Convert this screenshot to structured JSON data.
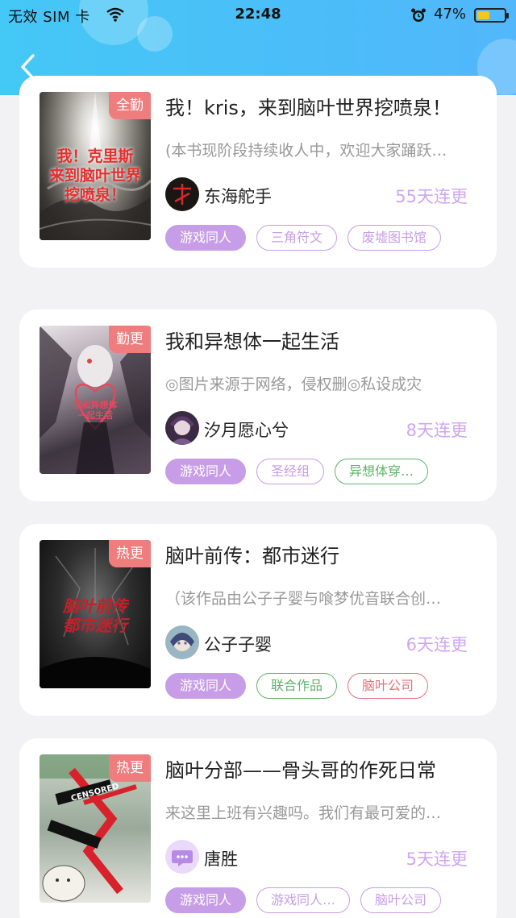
{
  "status_bar": {
    "carrier": "无效 SIM 卡",
    "time": "22:48",
    "battery": "47%",
    "battery_level": 0.47
  },
  "header": {
    "back_icon": "chevron-left-icon"
  },
  "books": [
    {
      "badge": "全勤",
      "cover_text": "我！克里斯\n来到脑叶世界\n挖喷泉！",
      "title": "我！kris，来到脑叶世界挖喷泉！",
      "description": "(本书现阶段持续收人中，欢迎大家踊跃…",
      "author": "东海舵手",
      "streak": "55天连更",
      "tags": [
        {
          "label": "游戏同人",
          "style": "fill"
        },
        {
          "label": "三角符文",
          "style": "purple"
        },
        {
          "label": "废墟图书馆",
          "style": "purple"
        }
      ]
    },
    {
      "badge": "勤更",
      "cover_text": "我和异想体\n一起生活",
      "title": "我和异想体一起生活",
      "description": "◎图片来源于网络，侵权删◎私设成灾",
      "author": "汐月愿心兮",
      "streak": "8天连更",
      "tags": [
        {
          "label": "游戏同人",
          "style": "fill"
        },
        {
          "label": "圣经组",
          "style": "purple"
        },
        {
          "label": "异想体穿…",
          "style": "green"
        }
      ]
    },
    {
      "badge": "热更",
      "cover_text": "脑叶前传\n都市迷行",
      "title": "脑叶前传：都市迷行",
      "description": "（该作品由公子子婴与喰梦优音联合创…",
      "author": "公子子婴",
      "streak": "6天连更",
      "tags": [
        {
          "label": "游戏同人",
          "style": "fill"
        },
        {
          "label": "联合作品",
          "style": "green"
        },
        {
          "label": "脑叶公司",
          "style": "red"
        }
      ]
    },
    {
      "badge": "热更",
      "cover_text": "CENSORED",
      "title": "脑叶分部——骨头哥的作死日常",
      "description": "来这里上班有兴趣吗。我们有最可爱的…",
      "author": "唐胜",
      "streak": "5天连更",
      "tags": [
        {
          "label": "游戏同人",
          "style": "fill"
        },
        {
          "label": "游戏同人…",
          "style": "purple"
        },
        {
          "label": "脑叶公司",
          "style": "purple"
        }
      ]
    }
  ]
}
